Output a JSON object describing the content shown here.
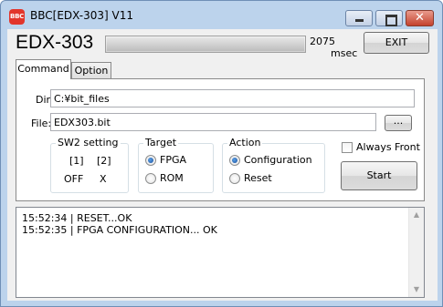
{
  "window": {
    "title": "BBC[EDX-303] V11",
    "icon_text": "BBC",
    "icons": {
      "minimize": "minimize-icon",
      "maximize": "maximize-icon",
      "close": "close-icon"
    },
    "colors": {
      "accent": "#e2352b",
      "frame": "#bcd3ec",
      "close_button": "#c4422e"
    }
  },
  "header": {
    "device_name": "EDX-303",
    "progress_percent": 100,
    "elapsed_value": "2075",
    "elapsed_unit": "msec",
    "exit_label": "EXIT"
  },
  "tabs": [
    {
      "label": "Command",
      "selected": true
    },
    {
      "label": "Option",
      "selected": false
    }
  ],
  "command": {
    "dir_label": "Dir:",
    "dir_value": "C:¥bit_files",
    "file_label": "File:",
    "file_value": "EDX303.bit",
    "browse_label": "...",
    "sw2": {
      "title": "SW2 setting",
      "headers": [
        "[1]",
        "[2]"
      ],
      "values": [
        "OFF",
        "X"
      ]
    },
    "target": {
      "title": "Target",
      "options": [
        {
          "label": "FPGA",
          "checked": true
        },
        {
          "label": "ROM",
          "checked": false
        }
      ]
    },
    "action": {
      "title": "Action",
      "options": [
        {
          "label": "Configuration",
          "checked": true
        },
        {
          "label": "Reset",
          "checked": false
        }
      ]
    },
    "always_front_label": "Always Front",
    "always_front_checked": false,
    "start_label": "Start"
  },
  "log": {
    "lines": [
      "15:52:34 | RESET...OK",
      "15:52:35 | FPGA CONFIGURATION... OK"
    ],
    "scroll_up_glyph": "▲",
    "scroll_down_glyph": "▼"
  }
}
